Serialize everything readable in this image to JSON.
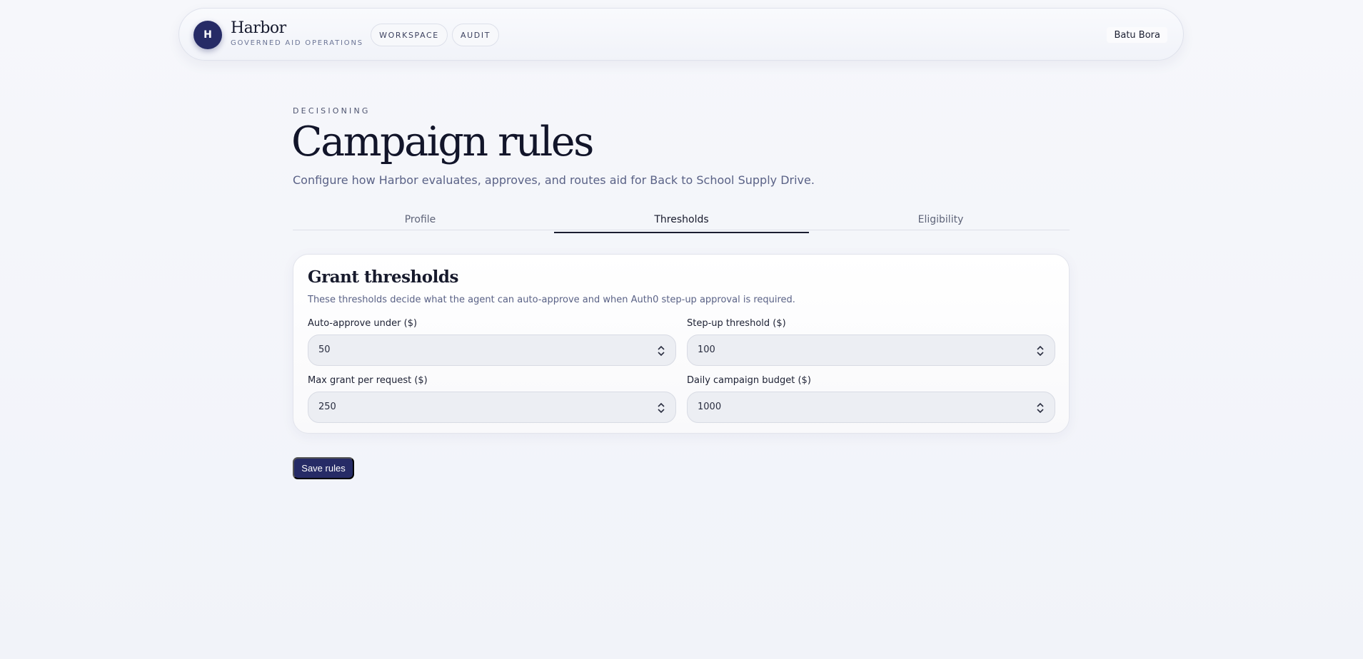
{
  "header": {
    "logo_letter": "H",
    "brand_name": "Harbor",
    "tagline": "GOVERNED AID OPERATIONS",
    "nav": [
      {
        "label": "WORKSPACE"
      },
      {
        "label": "AUDIT"
      }
    ],
    "user_name": "Batu Bora"
  },
  "page": {
    "eyebrow": "DECISIONING",
    "title": "Campaign rules",
    "subtitle": "Configure how Harbor evaluates, approves, and routes aid for Back to School Supply Drive."
  },
  "tabs": [
    {
      "label": "Profile",
      "active": false
    },
    {
      "label": "Thresholds",
      "active": true
    },
    {
      "label": "Eligibility",
      "active": false
    }
  ],
  "thresholds_card": {
    "title": "Grant thresholds",
    "description": "These thresholds decide what the agent can auto-approve and when Auth0 step-up approval is required.",
    "fields": [
      {
        "label": "Auto-approve under ($)",
        "value": "50"
      },
      {
        "label": "Step-up threshold ($)",
        "value": "100"
      },
      {
        "label": "Max grant per request ($)",
        "value": "250"
      },
      {
        "label": "Daily campaign budget ($)",
        "value": "1000"
      }
    ]
  },
  "actions": {
    "save_label": "Save rules"
  },
  "colors": {
    "accent": "#262b66",
    "background": "#f3f5fa",
    "input_bg": "#eceef3"
  },
  "icons": {
    "spinner": "chevron-up-down-icon"
  }
}
